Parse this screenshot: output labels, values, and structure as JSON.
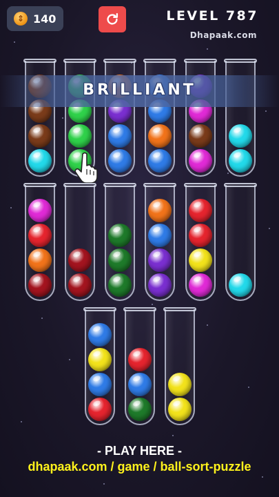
{
  "header": {
    "coins": "140",
    "coin_icon": "coin-icon",
    "restart_icon": "restart-icon",
    "level": "LEVEL 787",
    "watermark": "Dhapaak.com"
  },
  "banner": {
    "text": "BRILLIANT"
  },
  "colors": {
    "brown": "#7a3b1a",
    "cyan": "#22d9ea",
    "green": "#2fd14a",
    "purple": "#7a2fd0",
    "blue": "#2f7be6",
    "orange": "#f1731a",
    "magenta": "#e02ad6",
    "red": "#e5242e",
    "darkred": "#a3141f",
    "darkgreen": "#1e7a2a",
    "yellow": "#f2e21b"
  },
  "tubes": [
    {
      "row": 1,
      "balls": [
        "cyan",
        "brown",
        "brown",
        "brown"
      ]
    },
    {
      "row": 1,
      "balls": [
        "green",
        "green",
        "green",
        "green"
      ]
    },
    {
      "row": 1,
      "balls": [
        "blue",
        "blue",
        "purple",
        "orange"
      ]
    },
    {
      "row": 1,
      "balls": [
        "blue",
        "orange",
        "blue",
        "blue"
      ]
    },
    {
      "row": 1,
      "balls": [
        "magenta",
        "brown",
        "magenta",
        "purple"
      ]
    },
    {
      "row": 1,
      "balls": [
        "cyan",
        "cyan"
      ]
    },
    {
      "row": 2,
      "balls": [
        "darkred",
        "orange",
        "red",
        "magenta"
      ]
    },
    {
      "row": 2,
      "balls": [
        "darkred",
        "darkred"
      ]
    },
    {
      "row": 2,
      "balls": [
        "darkgreen",
        "darkgreen",
        "darkgreen"
      ]
    },
    {
      "row": 2,
      "balls": [
        "purple",
        "purple",
        "blue",
        "orange"
      ]
    },
    {
      "row": 2,
      "balls": [
        "magenta",
        "yellow",
        "red",
        "red"
      ]
    },
    {
      "row": 2,
      "balls": [
        "cyan"
      ]
    },
    {
      "row": 3,
      "balls": [
        "red",
        "blue",
        "yellow",
        "blue"
      ]
    },
    {
      "row": 3,
      "balls": [
        "darkgreen",
        "blue",
        "red"
      ]
    },
    {
      "row": 3,
      "balls": [
        "yellow",
        "yellow"
      ]
    }
  ],
  "footer": {
    "play_here": "- PLAY HERE -",
    "link": "dhapaak.com / game / ball-sort-puzzle"
  }
}
